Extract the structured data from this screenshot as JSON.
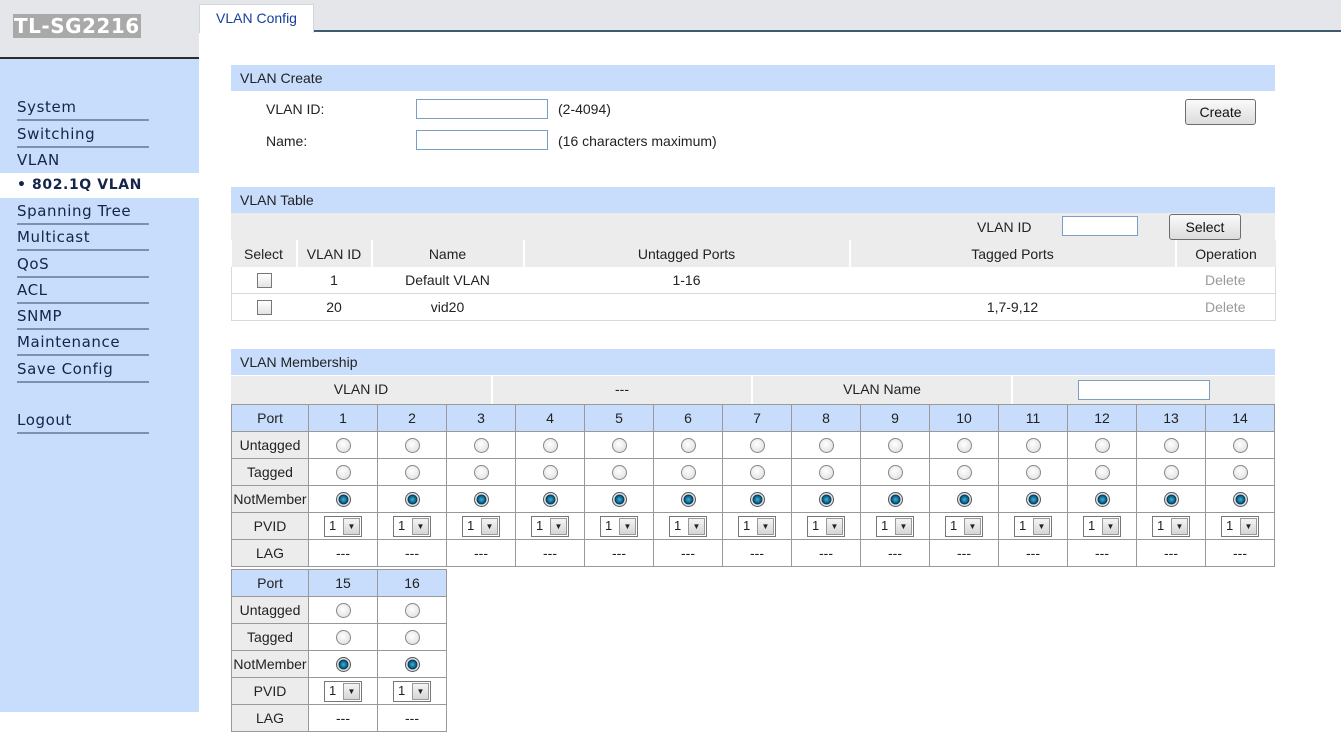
{
  "brand": "TL-SG2216",
  "sidebar": {
    "items": [
      {
        "label": "System"
      },
      {
        "label": "Switching"
      },
      {
        "label": "VLAN"
      },
      {
        "label": "Spanning Tree"
      },
      {
        "label": "Multicast"
      },
      {
        "label": "QoS"
      },
      {
        "label": "ACL"
      },
      {
        "label": "SNMP"
      },
      {
        "label": "Maintenance"
      },
      {
        "label": "Save Config"
      },
      {
        "label": "Logout"
      }
    ],
    "active": "• 802.1Q VLAN"
  },
  "tab": "VLAN Config",
  "create": {
    "title": "VLAN Create",
    "vlan_id_label": "VLAN ID:",
    "vlan_id_hint": "(2-4094)",
    "name_label": "Name:",
    "name_hint": "(16 characters maximum)",
    "create_button": "Create"
  },
  "table": {
    "title": "VLAN Table",
    "search_label": "VLAN ID",
    "select_button": "Select",
    "headers": [
      "Select",
      "VLAN ID",
      "Name",
      "Untagged Ports",
      "Tagged Ports",
      "Operation"
    ],
    "rows": [
      {
        "id": "1",
        "name": "Default VLAN",
        "untagged": "1-16",
        "tagged": "",
        "op": "Delete"
      },
      {
        "id": "20",
        "name": "vid20",
        "untagged": "",
        "tagged": "1,7-9,12",
        "op": "Delete"
      }
    ]
  },
  "membership": {
    "title": "VLAN Membership",
    "vlan_id_label": "VLAN ID",
    "vlan_id_value": "---",
    "vlan_name_label": "VLAN Name",
    "row_labels": {
      "port": "Port",
      "untagged": "Untagged",
      "tagged": "Tagged",
      "notmember": "NotMember",
      "pvid": "PVID",
      "lag": "LAG"
    },
    "ports": [
      "1",
      "2",
      "3",
      "4",
      "5",
      "6",
      "7",
      "8",
      "9",
      "10",
      "11",
      "12",
      "13",
      "14",
      "15",
      "16"
    ],
    "pvid_value": "1",
    "lag_value": "---",
    "selected": "NotMember"
  }
}
